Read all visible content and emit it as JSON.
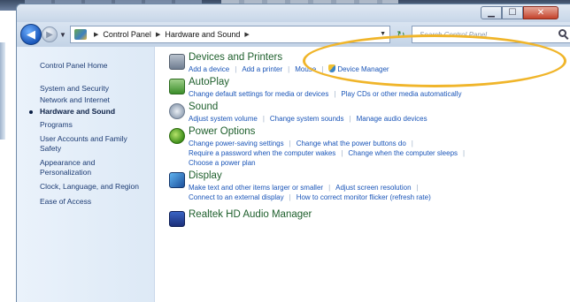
{
  "address_bar": {
    "crumbs": [
      "Control Panel",
      "Hardware and Sound"
    ]
  },
  "search": {
    "placeholder": "Search Control Panel"
  },
  "left_pane": {
    "items": [
      {
        "label": "Control Panel Home"
      },
      {
        "label": "System and Security"
      },
      {
        "label": "Network and Internet"
      },
      {
        "label": "Hardware and Sound",
        "active": true
      },
      {
        "label": "Programs"
      },
      {
        "label": "User Accounts and Family Safety"
      },
      {
        "label": "Appearance and Personalization"
      },
      {
        "label": "Clock, Language, and Region"
      },
      {
        "label": "Ease of Access"
      }
    ]
  },
  "categories": [
    {
      "title": "Devices and Printers",
      "icon": "printer-icon",
      "rows": [
        [
          "Add a device",
          "Add a printer",
          "Mouse",
          "Device Manager"
        ]
      ]
    },
    {
      "title": "AutoPlay",
      "icon": "autoplay-icon",
      "rows": [
        [
          "Change default settings for media or devices",
          "Play CDs or other media automatically"
        ]
      ]
    },
    {
      "title": "Sound",
      "icon": "sound-icon",
      "rows": [
        [
          "Adjust system volume",
          "Change system sounds",
          "Manage audio devices"
        ]
      ]
    },
    {
      "title": "Power Options",
      "icon": "power-icon",
      "rows": [
        [
          "Change power-saving settings",
          "Change what the power buttons do"
        ],
        [
          "Require a password when the computer wakes",
          "Change when the computer sleeps"
        ],
        [
          "Choose a power plan"
        ]
      ]
    },
    {
      "title": "Display",
      "icon": "display-icon",
      "rows": [
        [
          "Make text and other items larger or smaller",
          "Adjust screen resolution"
        ],
        [
          "Connect to an external display",
          "How to correct monitor flicker (refresh rate)"
        ]
      ]
    },
    {
      "title": "Realtek HD Audio Manager",
      "icon": "realtek-audio-icon",
      "rows": []
    }
  ],
  "colors": {
    "highlight": "#f0b52a",
    "link": "#1a55b8",
    "category_title": "#1e5f2c"
  }
}
